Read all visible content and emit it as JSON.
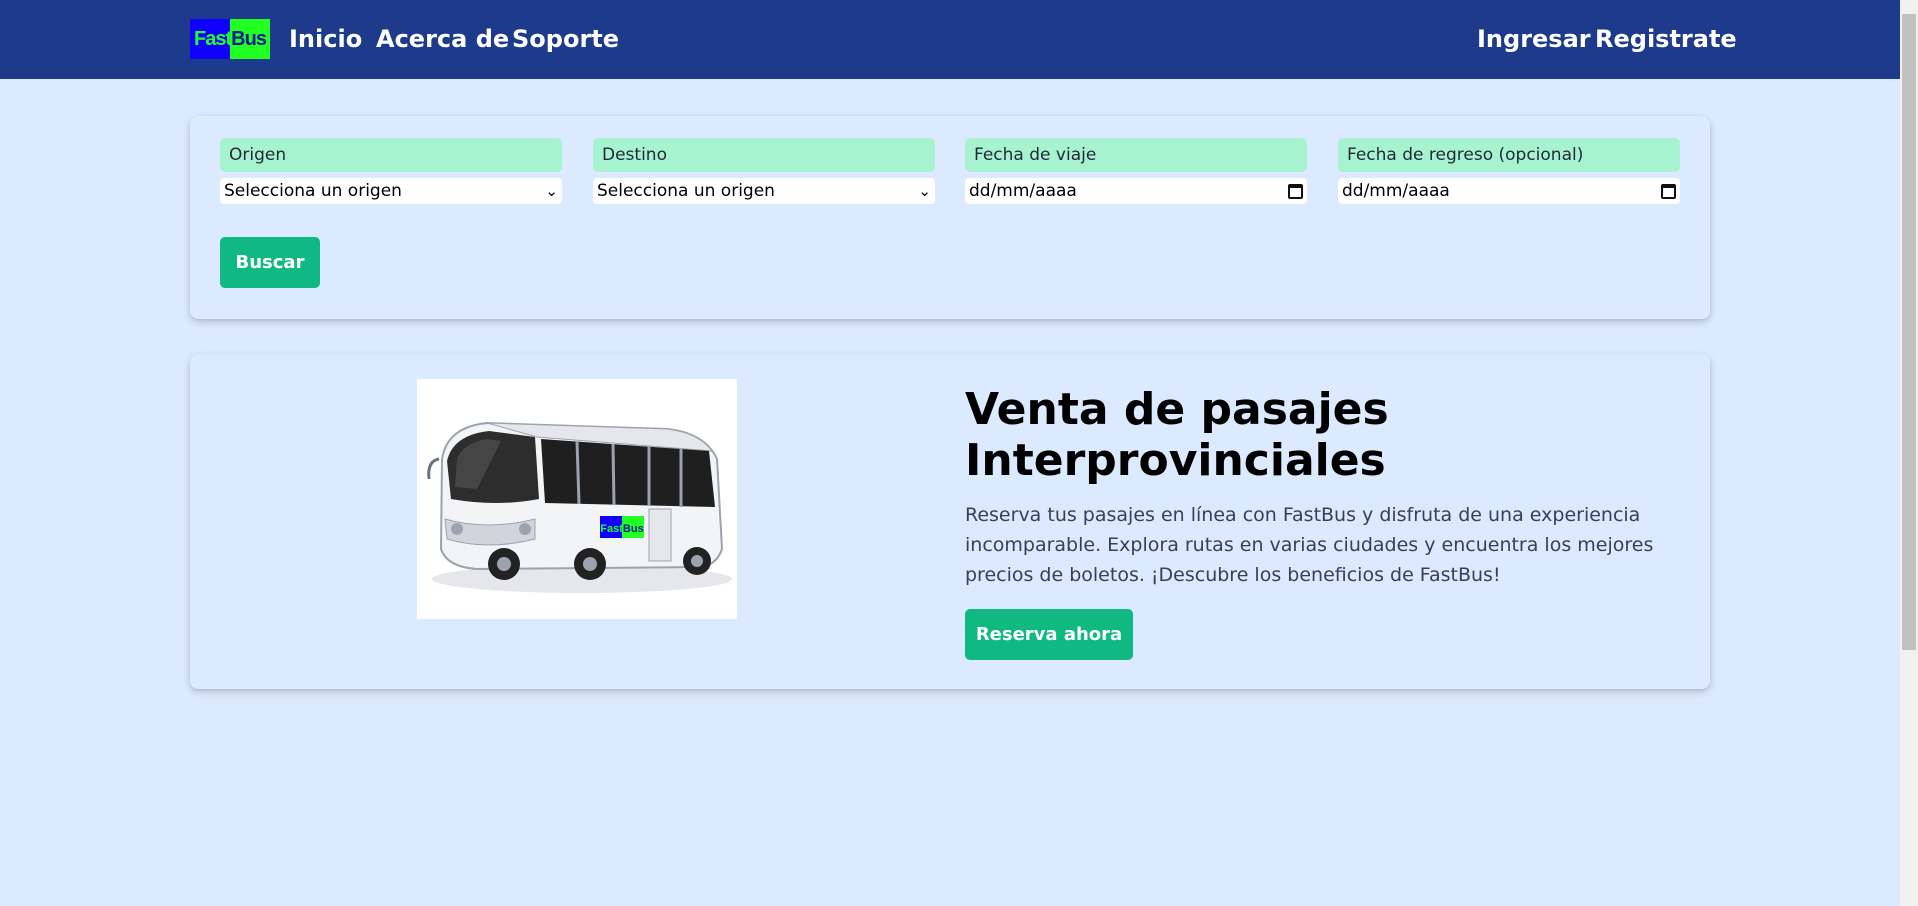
{
  "nav": {
    "logo_left": "Fast",
    "logo_right": "Bus",
    "links": [
      "Inicio",
      "Acerca de",
      "Soporte"
    ],
    "auth": {
      "login": "Ingresar",
      "register": "Registrate"
    }
  },
  "search": {
    "fields": [
      {
        "label": "Origen",
        "value": "Selecciona un origen",
        "type": "select"
      },
      {
        "label": "Destino",
        "value": "Selecciona un origen",
        "type": "select"
      },
      {
        "label": "Fecha de viaje",
        "value": "dd/mm/aaaa",
        "type": "date"
      },
      {
        "label": "Fecha de regreso (opcional)",
        "value": "dd/mm/aaaa",
        "type": "date"
      }
    ],
    "button": "Buscar"
  },
  "hero": {
    "title": "Venta de pasajes Interprovinciales",
    "description": "Reserva tus pasajes en línea con FastBus y disfruta de una experiencia incomparable. Explora rutas en varias ciudades y encuentra los mejores precios de boletos. ¡Descubre los beneficios de FastBus!",
    "button": "Reserva ahora",
    "bus_logo_left": "Fast",
    "bus_logo_right": "Bus"
  },
  "colors": {
    "navbar": "#1e3a8a",
    "page_bg": "#dbeafe",
    "label_bg": "#a7f3d0",
    "button": "#10b981"
  },
  "icons": {
    "select": "chevron-down-icon",
    "date": "calendar-icon"
  }
}
